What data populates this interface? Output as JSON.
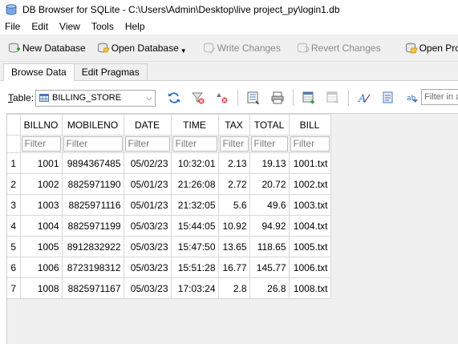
{
  "window": {
    "title": "DB Browser for SQLite - C:\\Users\\Admin\\Desktop\\live project_py\\login1.db"
  },
  "menu": [
    "File",
    "Edit",
    "View",
    "Tools",
    "Help"
  ],
  "toolbar": {
    "new_db": "New Database",
    "open_db": "Open Database",
    "write": "Write Changes",
    "revert": "Revert Changes",
    "open_project": "Open Project"
  },
  "tabs": {
    "browse": "Browse Data",
    "pragmas": "Edit Pragmas"
  },
  "table_selector": {
    "label_prefix": "T",
    "label_rest": "able:",
    "value": "BILLING_STORE"
  },
  "filter_all_placeholder": "Filter in a",
  "columns": [
    "BILLNO",
    "MOBILENO",
    "DATE",
    "TIME",
    "TAX",
    "TOTAL",
    "BILL"
  ],
  "filter_placeholder": "Filter",
  "rows": [
    {
      "n": "1",
      "cells": [
        "1001",
        "9894367485",
        "05/02/23",
        "10:32:01",
        "2.13",
        "19.13",
        "1001.txt"
      ]
    },
    {
      "n": "2",
      "cells": [
        "1002",
        "8825971190",
        "05/01/23",
        "21:26:08",
        "2.72",
        "20.72",
        "1002.txt"
      ]
    },
    {
      "n": "3",
      "cells": [
        "1003",
        "8825971116",
        "05/01/23",
        "21:32:05",
        "5.6",
        "49.6",
        "1003.txt"
      ]
    },
    {
      "n": "4",
      "cells": [
        "1004",
        "8825971199",
        "05/03/23",
        "15:44:05",
        "10.92",
        "94.92",
        "1004.txt"
      ]
    },
    {
      "n": "5",
      "cells": [
        "1005",
        "8912832922",
        "05/03/23",
        "15:47:50",
        "13.65",
        "118.65",
        "1005.txt"
      ]
    },
    {
      "n": "6",
      "cells": [
        "1006",
        "8723198312",
        "05/03/23",
        "15:51:28",
        "16.77",
        "145.77",
        "1006.txt"
      ]
    },
    {
      "n": "7",
      "cells": [
        "1008",
        "8825971167",
        "05/03/23",
        "17:03:24",
        "2.8",
        "26.8",
        "1008.txt"
      ]
    }
  ]
}
